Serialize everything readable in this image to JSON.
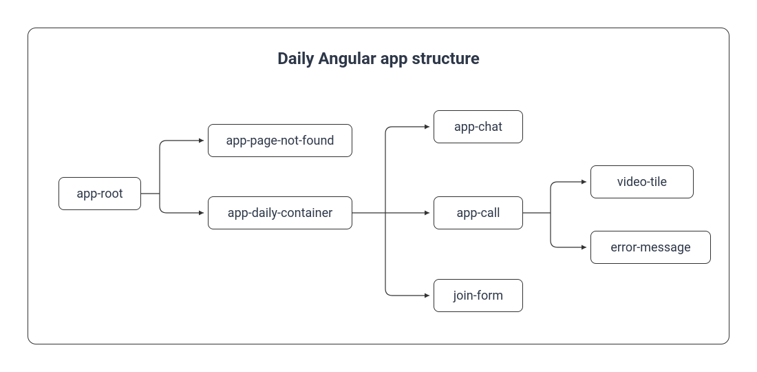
{
  "title": "Daily Angular app structure",
  "nodes": {
    "root": "app-root",
    "pnf": "app-page-not-found",
    "container": "app-daily-container",
    "chat": "app-chat",
    "call": "app-call",
    "join": "join-form",
    "videotile": "video-tile",
    "errmsg": "error-message"
  },
  "edges": [
    [
      "app-root",
      "app-page-not-found"
    ],
    [
      "app-root",
      "app-daily-container"
    ],
    [
      "app-daily-container",
      "app-chat"
    ],
    [
      "app-daily-container",
      "app-call"
    ],
    [
      "app-daily-container",
      "join-form"
    ],
    [
      "app-call",
      "video-tile"
    ],
    [
      "app-call",
      "error-message"
    ]
  ],
  "colors": {
    "stroke": "#333333",
    "text": "#2d3748",
    "background": "#ffffff"
  }
}
